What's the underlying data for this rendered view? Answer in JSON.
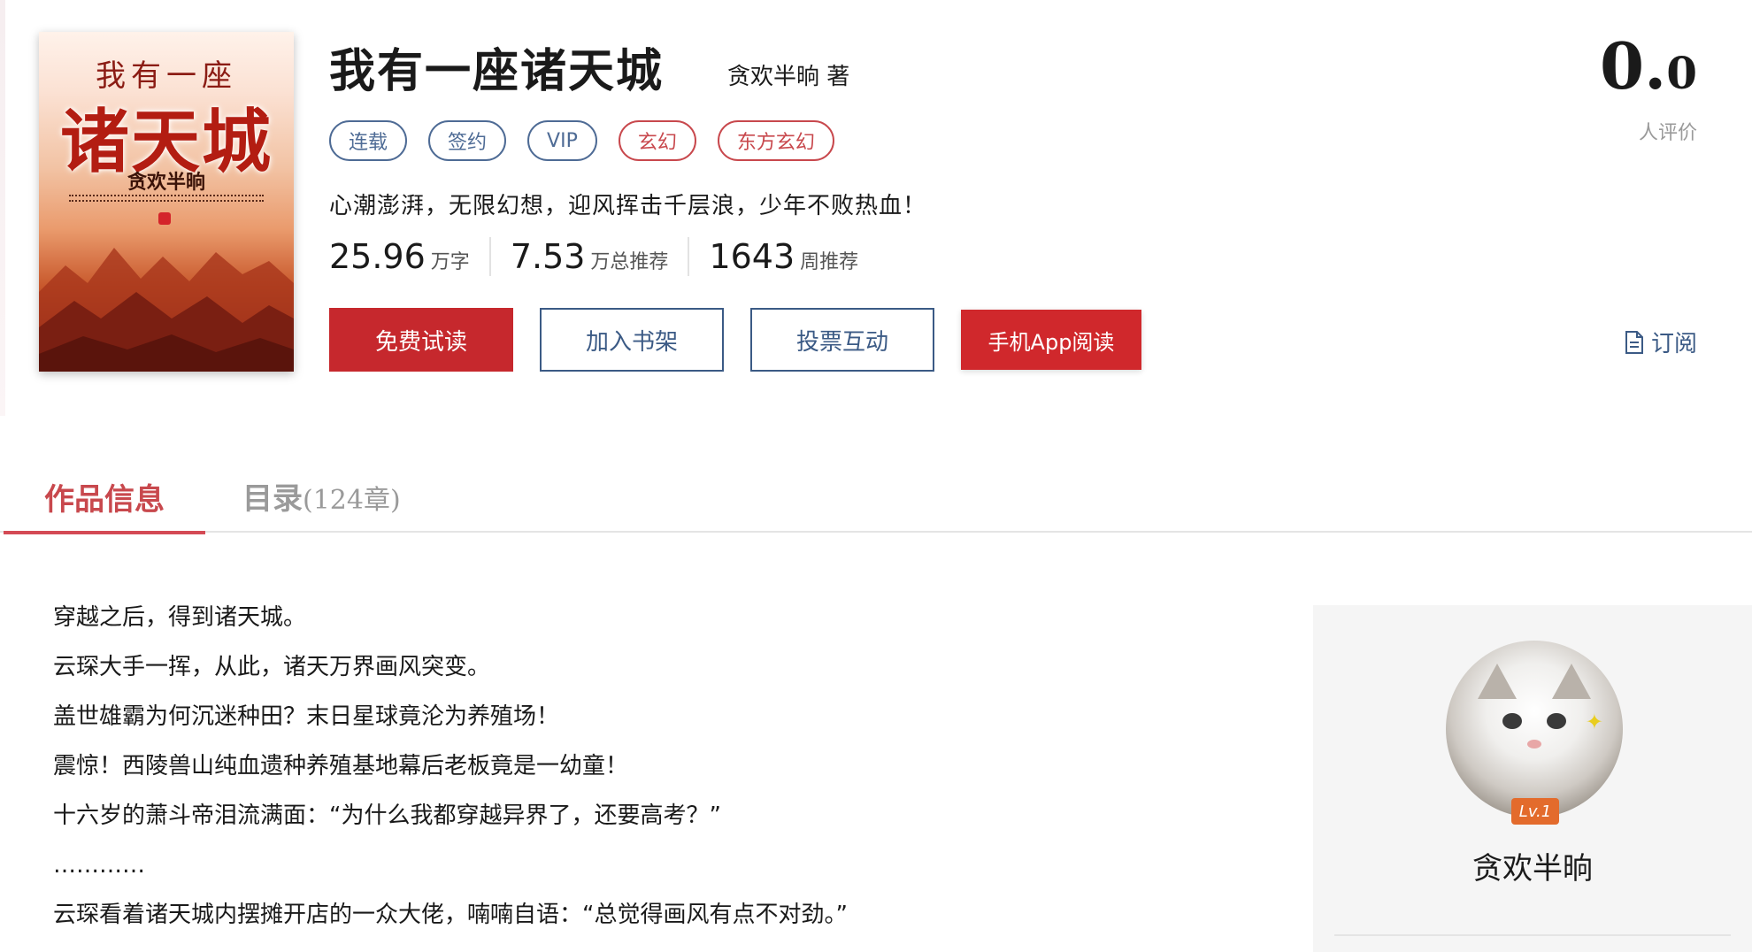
{
  "cover": {
    "line1": "我有一座",
    "line2": "诸天城",
    "author": "贪欢半晌"
  },
  "book": {
    "title": "我有一座诸天城",
    "author": "贪欢半晌 著",
    "tags": [
      {
        "label": "连载",
        "style": "blue"
      },
      {
        "label": "签约",
        "style": "blue"
      },
      {
        "label": "VIP",
        "style": "blue"
      },
      {
        "label": "玄幻",
        "style": "red"
      },
      {
        "label": "东方玄幻",
        "style": "red"
      }
    ],
    "intro": "心潮澎湃，无限幻想，迎风挥击千层浪，少年不败热血！",
    "stats": [
      {
        "value": "25.96",
        "unit": "万字"
      },
      {
        "value": "7.53",
        "unit": "万总推荐"
      },
      {
        "value": "1643",
        "unit": "周推荐"
      }
    ]
  },
  "buttons": {
    "free_read": "免费试读",
    "add_shelf": "加入书架",
    "vote": "投票互动",
    "app_read": "手机App阅读"
  },
  "rating": {
    "score_int": "0.",
    "score_dec": "0",
    "label": "人评价"
  },
  "subscribe": {
    "label": "订阅",
    "icon": "document-icon"
  },
  "tabs": {
    "info": "作品信息",
    "catalog": "目录",
    "catalog_count": "(124章)"
  },
  "description": [
    "穿越之后，得到诸天城。",
    "云琛大手一挥，从此，诸天万界画风突变。",
    "盖世雄霸为何沉迷种田？末日星球竟沦为养殖场！",
    "震惊！西陵兽山纯血遗种养殖基地幕后老板竟是一幼童！",
    "十六岁的萧斗帝泪流满面：“为什么我都穿越异界了，还要高考？”",
    "…………",
    "云琛看着诸天城内摆摊开店的一众大佬，喃喃自语：“总觉得画风有点不对劲。”"
  ],
  "author_card": {
    "level": "Lv.1",
    "name": "贪欢半晌"
  },
  "colors": {
    "accent_red": "#c6282d",
    "tag_blue": "#4e6b95",
    "tab_red": "#c8484d"
  }
}
